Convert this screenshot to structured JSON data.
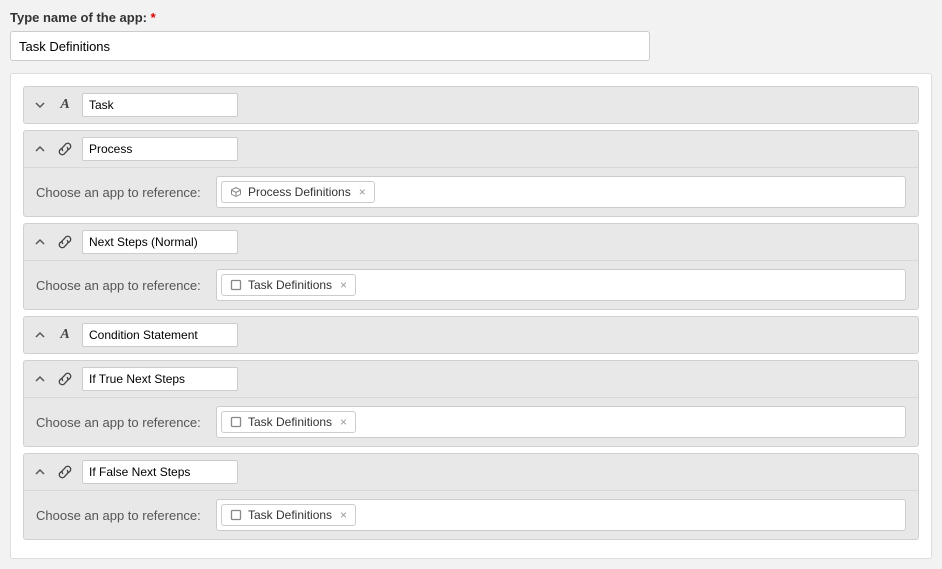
{
  "appNameLabel": "Type name of the app:",
  "requiredMark": "*",
  "appNameValue": "Task Definitions",
  "refLabel": "Choose an app to reference:",
  "removeMark": "×",
  "fields": [
    {
      "name": "Task",
      "type": "text",
      "expanded": false
    },
    {
      "name": "Process",
      "type": "link",
      "expanded": true,
      "ref": {
        "icon": "cube",
        "label": "Process Definitions"
      }
    },
    {
      "name": "Next Steps (Normal)",
      "type": "link",
      "expanded": true,
      "ref": {
        "icon": "square",
        "label": "Task Definitions"
      }
    },
    {
      "name": "Condition Statement",
      "type": "text",
      "expanded": false
    },
    {
      "name": "If True Next Steps",
      "type": "link",
      "expanded": true,
      "ref": {
        "icon": "square",
        "label": "Task Definitions"
      }
    },
    {
      "name": "If False Next Steps",
      "type": "link",
      "expanded": true,
      "ref": {
        "icon": "square",
        "label": "Task Definitions"
      }
    }
  ]
}
